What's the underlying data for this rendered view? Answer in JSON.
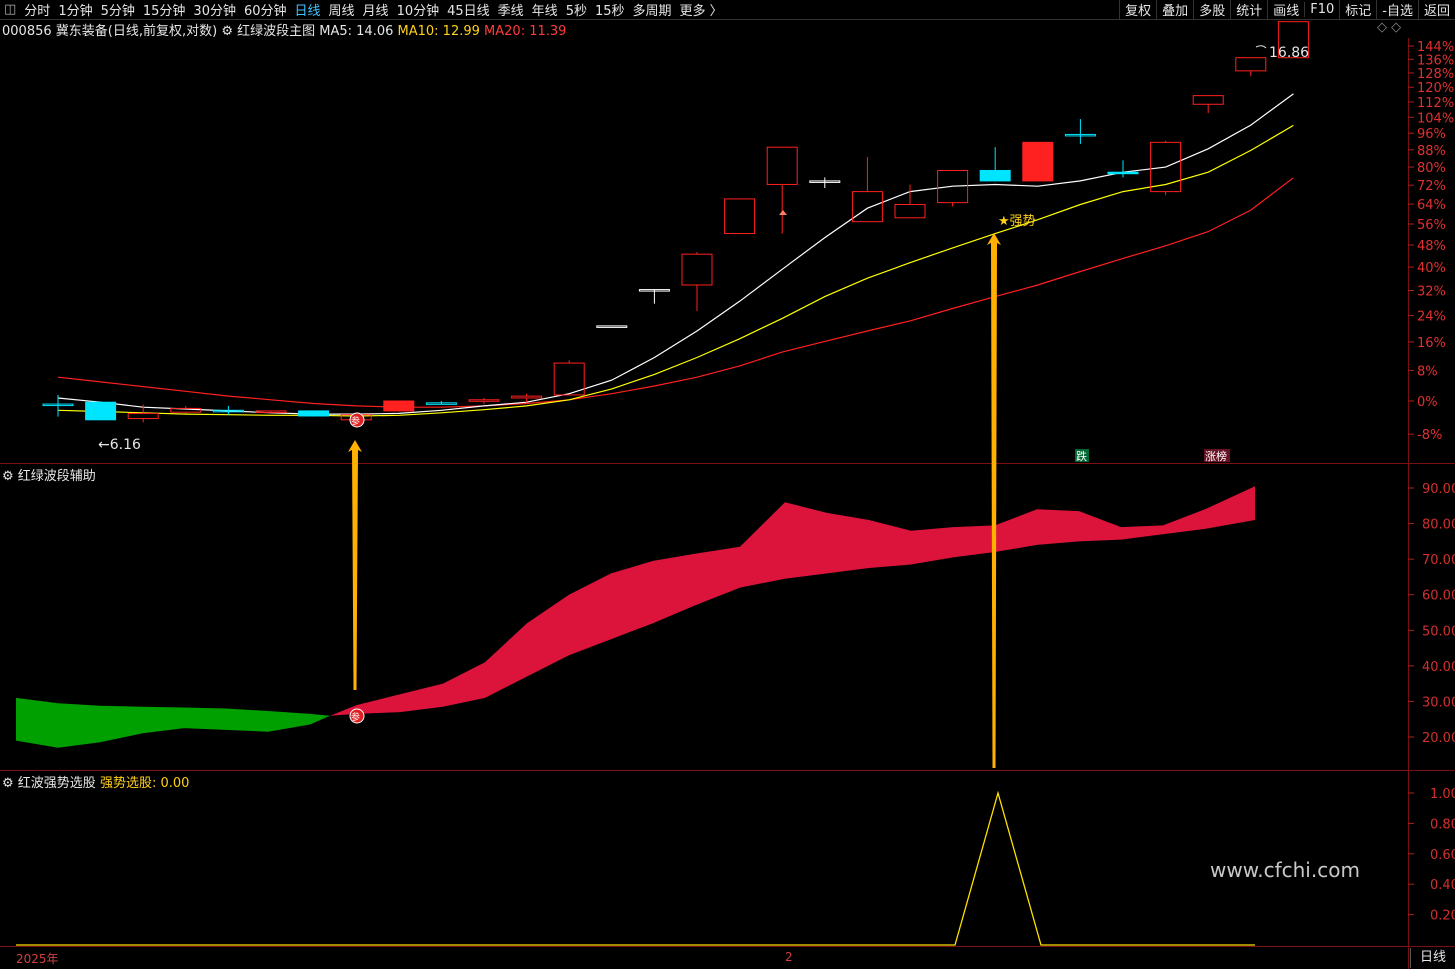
{
  "toolbar": {
    "left_items": [
      "分时",
      "1分钟",
      "5分钟",
      "15分钟",
      "30分钟",
      "60分钟",
      "日线",
      "周线",
      "月线",
      "10分钟",
      "45日线",
      "季线",
      "年线",
      "5秒",
      "15秒",
      "多周期",
      "更多 〉"
    ],
    "active": "日线",
    "right_items": [
      "复权",
      "叠加",
      "多股",
      "统计",
      "画线",
      "F10",
      "标记",
      "-自选",
      "返回"
    ]
  },
  "main_header": {
    "stock": "000856 冀东装备(日线,前复权,对数)",
    "indicator": "红绿波段主图",
    "ma5": "MA5: 14.06",
    "ma10": "MA10: 12.99",
    "ma20": "MA20: 11.39"
  },
  "aux_header": {
    "title": "红绿波段辅助"
  },
  "sel_header": {
    "title": "红波强势选股",
    "value": "强势选股: 0.00"
  },
  "annotations": {
    "high": "16.86",
    "low": "←6.16",
    "strong": "★强势",
    "die": "跌",
    "zhangting": "涨榜",
    "marker": "参"
  },
  "pct_axis": [
    "144%",
    "136%",
    "128%",
    "120%",
    "112%",
    "104%",
    "96%",
    "88%",
    "80%",
    "72%",
    "64%",
    "56%",
    "48%",
    "40%",
    "32%",
    "24%",
    "16%",
    "8%",
    "0%",
    "-8%"
  ],
  "aux_axis": [
    "90.00",
    "80.00",
    "70.00",
    "60.00",
    "50.00",
    "40.00",
    "30.00",
    "20.00"
  ],
  "sel_axis": [
    "1.00",
    "0.80",
    "0.60",
    "0.40",
    "0.20"
  ],
  "bottom": {
    "year": "2025年",
    "month": "2",
    "period": "日线"
  },
  "watermark": "www.cfchi.com",
  "colors": {
    "up": "#ff2020",
    "down": "#00e5ff",
    "ma5": "#ffffff",
    "ma10": "#ffff00",
    "ma20": "#ff2020",
    "band_red": "#dc143c",
    "band_green": "#00a000",
    "arrow": "#ffb000"
  },
  "chart_data": {
    "type": "candlestick",
    "candles": [
      {
        "o": 6.45,
        "h": 6.6,
        "l": 6.25,
        "c": 6.45,
        "dir": "flat"
      },
      {
        "o": 6.48,
        "h": 6.48,
        "l": 6.3,
        "c": 6.2,
        "dir": "down"
      },
      {
        "o": 6.3,
        "h": 6.44,
        "l": 6.16,
        "c": 6.22,
        "dir": "up-hollow"
      },
      {
        "o": 6.32,
        "h": 6.42,
        "l": 6.3,
        "c": 6.38,
        "dir": "up-hollow"
      },
      {
        "o": 6.35,
        "h": 6.42,
        "l": 6.28,
        "c": 6.35,
        "dir": "flat"
      },
      {
        "o": 6.34,
        "h": 6.34,
        "l": 6.32,
        "c": 6.33,
        "dir": "flat-red"
      },
      {
        "o": 6.34,
        "h": 6.34,
        "l": 6.25,
        "c": 6.26,
        "dir": "down"
      },
      {
        "o": 6.28,
        "h": 6.3,
        "l": 6.17,
        "c": 6.2,
        "dir": "up-hollow"
      },
      {
        "o": 6.34,
        "h": 6.5,
        "l": 6.33,
        "c": 6.5,
        "dir": "up-solid"
      },
      {
        "o": 6.47,
        "h": 6.5,
        "l": 6.45,
        "c": 6.47,
        "dir": "flat"
      },
      {
        "o": 6.5,
        "h": 6.55,
        "l": 6.45,
        "c": 6.52,
        "dir": "flat-red"
      },
      {
        "o": 6.55,
        "h": 6.62,
        "l": 6.48,
        "c": 6.58,
        "dir": "up-hollow"
      },
      {
        "o": 6.6,
        "h": 7.2,
        "l": 6.6,
        "c": 7.15,
        "dir": "up-hollow"
      },
      {
        "o": 7.85,
        "h": 7.85,
        "l": 7.85,
        "c": 7.85,
        "dir": "flat-white"
      },
      {
        "o": 8.6,
        "h": 8.6,
        "l": 8.3,
        "c": 8.6,
        "dir": "flat-white"
      },
      {
        "o": 8.7,
        "h": 9.45,
        "l": 8.15,
        "c": 9.4,
        "dir": "up-hollow"
      },
      {
        "o": 9.9,
        "h": 10.8,
        "l": 9.9,
        "c": 10.8,
        "dir": "up-hollow"
      },
      {
        "o": 11.2,
        "h": 12.3,
        "l": 9.9,
        "c": 12.3,
        "dir": "up-hollow"
      },
      {
        "o": 11.3,
        "h": 11.4,
        "l": 11.1,
        "c": 11.3,
        "dir": "flat-white"
      },
      {
        "o": 10.2,
        "h": 12.0,
        "l": 10.2,
        "c": 11.0,
        "dir": "up-hollow"
      },
      {
        "o": 10.3,
        "h": 11.2,
        "l": 10.3,
        "c": 10.65,
        "dir": "up-hollow"
      },
      {
        "o": 10.7,
        "h": 11.6,
        "l": 10.6,
        "c": 11.6,
        "dir": "up-hollow"
      },
      {
        "o": 11.6,
        "h": 12.3,
        "l": 11.3,
        "c": 11.3,
        "dir": "down"
      },
      {
        "o": 11.3,
        "h": 12.45,
        "l": 11.3,
        "c": 12.45,
        "dir": "up-solid"
      },
      {
        "o": 12.7,
        "h": 13.2,
        "l": 12.4,
        "c": 12.7,
        "dir": "flat"
      },
      {
        "o": 11.55,
        "h": 11.9,
        "l": 11.4,
        "c": 11.55,
        "dir": "flat-cyan"
      },
      {
        "o": 11.0,
        "h": 12.5,
        "l": 10.9,
        "c": 12.45,
        "dir": "up-hollow"
      },
      {
        "o": 13.7,
        "h": 14.0,
        "l": 13.4,
        "c": 14.0,
        "dir": "up-hollow"
      },
      {
        "o": 14.9,
        "h": 15.4,
        "l": 14.7,
        "c": 15.4,
        "dir": "up-hollow"
      },
      {
        "o": 15.4,
        "h": 16.86,
        "l": 15.4,
        "c": 16.86,
        "dir": "up-hollow"
      }
    ],
    "ma5": [
      6.55,
      6.48,
      6.4,
      6.37,
      6.34,
      6.31,
      6.29,
      6.29,
      6.3,
      6.35,
      6.42,
      6.48,
      6.62,
      6.85,
      7.25,
      7.75,
      8.35,
      9.05,
      9.8,
      10.55,
      11.0,
      11.15,
      11.2,
      11.15,
      11.3,
      11.55,
      11.7,
      12.25,
      13.0,
      14.06
    ],
    "ma10": [
      6.35,
      6.33,
      6.31,
      6.29,
      6.28,
      6.27,
      6.27,
      6.26,
      6.27,
      6.31,
      6.36,
      6.42,
      6.52,
      6.7,
      6.95,
      7.25,
      7.6,
      8.0,
      8.45,
      8.85,
      9.2,
      9.55,
      9.9,
      10.25,
      10.65,
      11.0,
      11.2,
      11.55,
      12.2,
      12.99
    ],
    "ma20": [
      6.9,
      6.82,
      6.74,
      6.66,
      6.58,
      6.52,
      6.46,
      6.42,
      6.4,
      6.4,
      6.42,
      6.46,
      6.52,
      6.62,
      6.75,
      6.9,
      7.1,
      7.35,
      7.55,
      7.75,
      7.95,
      8.2,
      8.45,
      8.7,
      9.0,
      9.3,
      9.6,
      9.95,
      10.5,
      11.39
    ]
  }
}
